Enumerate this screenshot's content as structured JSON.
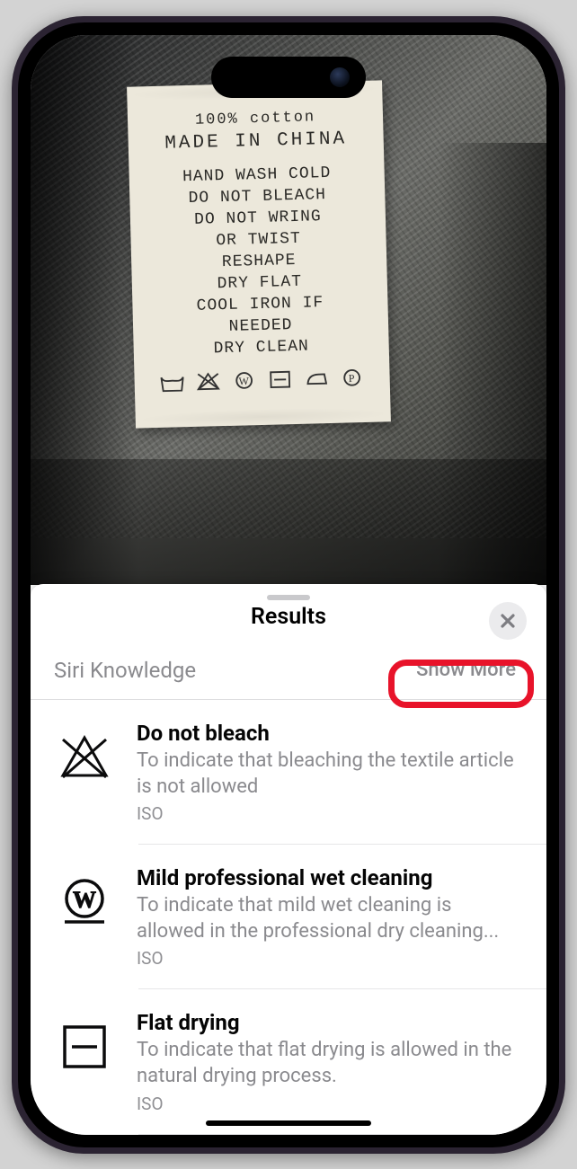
{
  "tag_label": {
    "content": "100% cotton",
    "origin": "MADE IN CHINA",
    "instructions": [
      "HAND WASH COLD",
      "DO NOT BLEACH",
      "DO NOT WRING",
      "OR TWIST",
      "RESHAPE",
      "DRY FLAT",
      "COOL IRON IF",
      "NEEDED",
      "DRY CLEAN"
    ]
  },
  "sheet": {
    "title": "Results",
    "section_label": "Siri Knowledge",
    "show_more_label": "Show More"
  },
  "results": [
    {
      "icon": "do-not-bleach-icon",
      "title": "Do not bleach",
      "desc": "To indicate that bleaching the textile article is not allowed",
      "source": "ISO"
    },
    {
      "icon": "wet-cleaning-w-icon",
      "title": "Mild professional wet cleaning",
      "desc": "To indicate that mild wet cleaning is allowed in the professional dry cleaning...",
      "source": "ISO"
    },
    {
      "icon": "flat-drying-icon",
      "title": "Flat drying",
      "desc": "To indicate that flat drying is allowed in the natural drying process.",
      "source": "ISO"
    }
  ]
}
